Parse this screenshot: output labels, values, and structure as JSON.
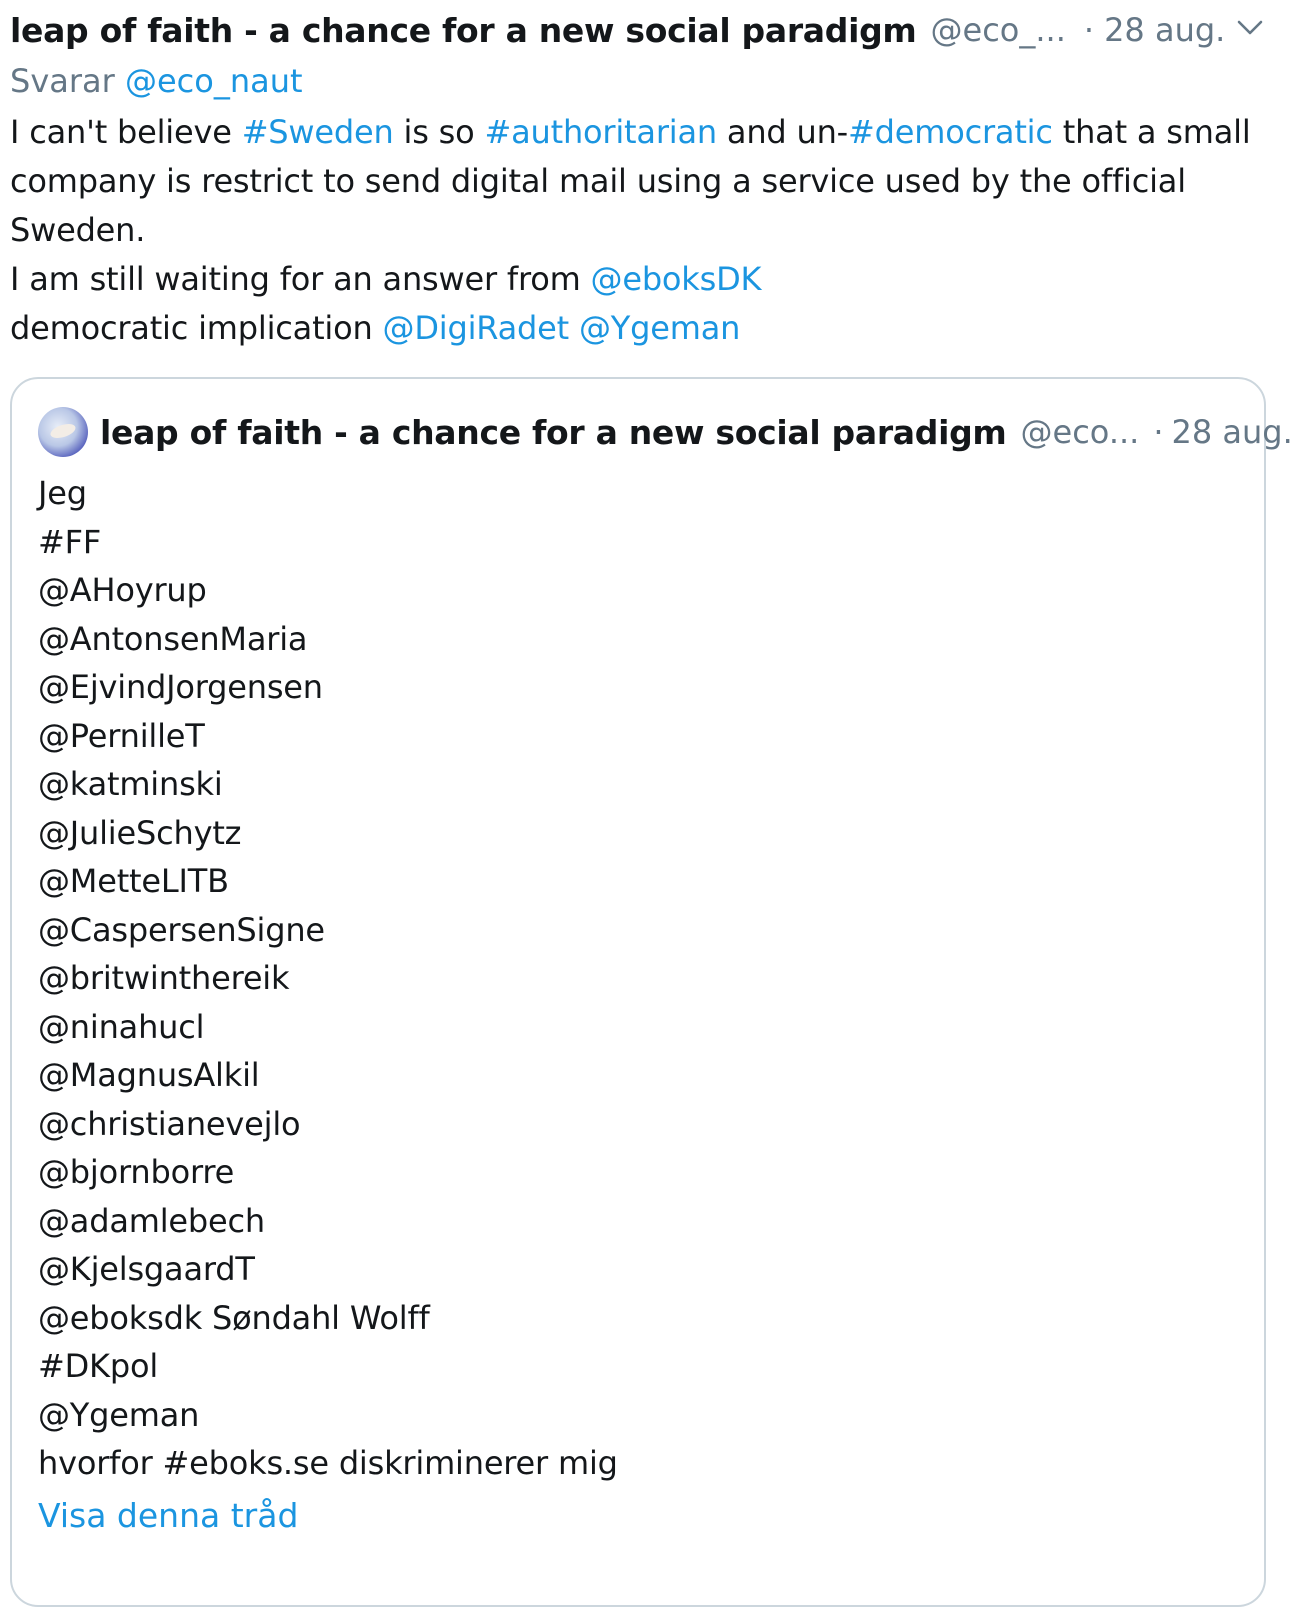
{
  "tweet": {
    "author_name": "leap of faith - a chance for a new social paradigm",
    "handle": "@eco_...",
    "separator": "·",
    "date": "28 aug.",
    "reply_prefix": "Svarar",
    "reply_handle": "@eco_naut",
    "text_lines": [
      [
        {
          "t": "I can't believe ",
          "link": false
        },
        {
          "t": "#Sweden",
          "link": true
        },
        {
          "t": " is so ",
          "link": false
        },
        {
          "t": "#authoritarian",
          "link": true
        },
        {
          "t": " and un-",
          "link": false
        },
        {
          "t": "#democratic",
          "link": true
        },
        {
          "t": " that a small",
          "link": false
        }
      ],
      [
        {
          "t": "company is restrict to send digital mail using a service used by the official",
          "link": false
        }
      ],
      [
        {
          "t": "Sweden.",
          "link": false
        }
      ],
      [
        {
          "t": "I am still waiting for an answer from ",
          "link": false
        },
        {
          "t": "@eboksDK",
          "link": true
        }
      ],
      [
        {
          "t": "democratic implication ",
          "link": false
        },
        {
          "t": "@DigiRadet",
          "link": true
        },
        {
          "t": " ",
          "link": false
        },
        {
          "t": "@Ygeman",
          "link": true
        }
      ]
    ]
  },
  "quote": {
    "author_name": "leap of faith - a chance for a new social paradigm",
    "handle": "@eco...",
    "separator": "·",
    "date": "28 aug.",
    "lines": [
      "Jeg",
      "#FF",
      "@AHoyrup",
      "@AntonsenMaria",
      "@EjvindJorgensen",
      "@PernilleT",
      "@katminski",
      "@JulieSchytz",
      "@MetteLITB",
      "@CaspersenSigne",
      "@britwinthereik",
      "@ninahucl",
      "@MagnusAlkil",
      "@christianevejlo",
      "@bjornborre",
      "@adamlebech",
      "@KjelsgaardT",
      "@eboksdk Søndahl Wolff",
      "#DKpol",
      "@Ygeman",
      "hvorfor #eboks.se diskriminerer mig"
    ],
    "show_thread": "Visa denna tråd"
  },
  "icons": {
    "menu": "chevron-down-icon",
    "avatar": "avatar-image"
  },
  "colors": {
    "link": "#1b95e0",
    "muted": "#657786",
    "text": "#14171a",
    "border": "#ccd6dd"
  }
}
